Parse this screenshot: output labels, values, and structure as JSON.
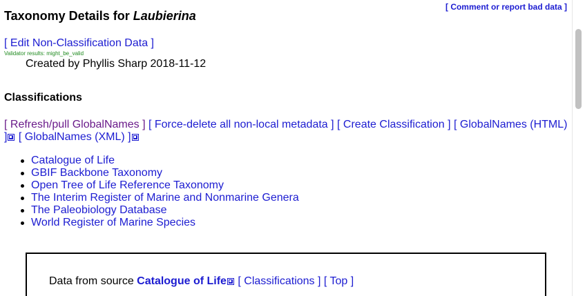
{
  "header": {
    "report_link": "[ Comment or report bad data ]",
    "title_prefix": "Taxonomy Details for ",
    "taxon_name": "Laubierina"
  },
  "meta": {
    "edit_link": "[ Edit Non-Classification Data ]",
    "validator": "Validator results: might_be_valid",
    "created": "Created by Phyllis Sharp 2018-11-12"
  },
  "classifications": {
    "heading": "Classifications",
    "actions": {
      "refresh": "[ Refresh/pull GlobalNames ]",
      "force_delete": "[ Force-delete all non-local metadata ]",
      "create": "[ Create Classification ]",
      "gn_html_open": "[ GlobalNames (HTML)",
      "gn_html_close": "]",
      "gn_xml": "[ GlobalNames (XML) ]"
    },
    "sources": [
      "Catalogue of Life",
      "GBIF Backbone Taxonomy",
      "Open Tree of Life Reference Taxonomy",
      "The Interim Register of Marine and Nonmarine Genera",
      "The Paleobiology Database",
      "World Register of Marine Species"
    ]
  },
  "data_box": {
    "prefix": "Data from source ",
    "source_name": "Catalogue of Life",
    "classifications_link": "[ Classifications ]",
    "top_link": "[ Top ]"
  },
  "colors": {
    "link": "#1c1cd1",
    "visited_link": "#6a1b8a",
    "validator": "#1f8a1f"
  },
  "icons": {
    "external": "external-link-icon"
  }
}
